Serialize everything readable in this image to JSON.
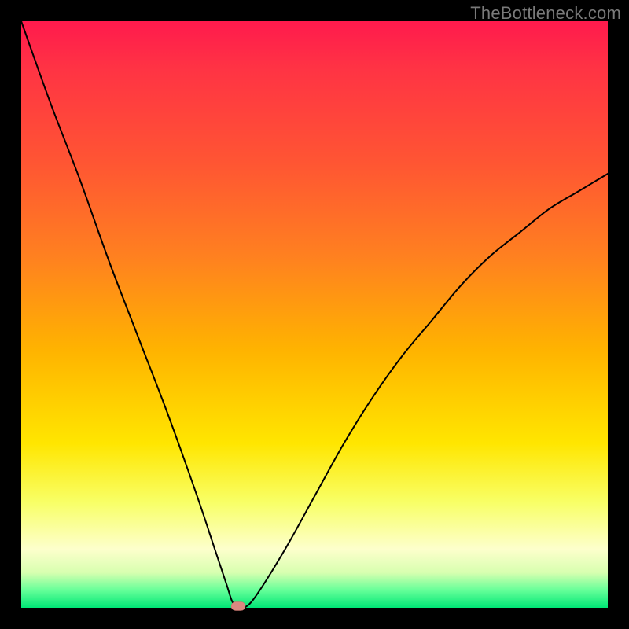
{
  "watermark": "TheBottleneck.com",
  "colors": {
    "frame": "#000000",
    "curve": "#000000",
    "marker_fill": "#d98880",
    "marker_stroke": "#c0706a"
  },
  "chart_data": {
    "type": "line",
    "title": "",
    "xlabel": "",
    "ylabel": "",
    "xlim": [
      0,
      100
    ],
    "ylim": [
      0,
      100
    ],
    "marker": {
      "x": 37,
      "y": 0
    },
    "series": [
      {
        "name": "bottleneck-curve",
        "x": [
          0,
          5,
          10,
          15,
          20,
          25,
          30,
          33,
          35,
          36,
          37,
          38,
          40,
          45,
          50,
          55,
          60,
          65,
          70,
          75,
          80,
          85,
          90,
          95,
          100
        ],
        "y": [
          100,
          86,
          73,
          59,
          46,
          33,
          19,
          10,
          4,
          1,
          0,
          0,
          2,
          10,
          19,
          28,
          36,
          43,
          49,
          55,
          60,
          64,
          68,
          71,
          74
        ]
      }
    ],
    "gradient_stops": [
      {
        "pos": 0.0,
        "color": "#ff1a4d"
      },
      {
        "pos": 0.08,
        "color": "#ff3344"
      },
      {
        "pos": 0.24,
        "color": "#ff5533"
      },
      {
        "pos": 0.4,
        "color": "#ff8020"
      },
      {
        "pos": 0.56,
        "color": "#ffb300"
      },
      {
        "pos": 0.72,
        "color": "#ffe600"
      },
      {
        "pos": 0.82,
        "color": "#f8ff66"
      },
      {
        "pos": 0.9,
        "color": "#fdffcc"
      },
      {
        "pos": 0.94,
        "color": "#d8ffb0"
      },
      {
        "pos": 0.97,
        "color": "#66ff99"
      },
      {
        "pos": 1.0,
        "color": "#00e676"
      }
    ]
  }
}
